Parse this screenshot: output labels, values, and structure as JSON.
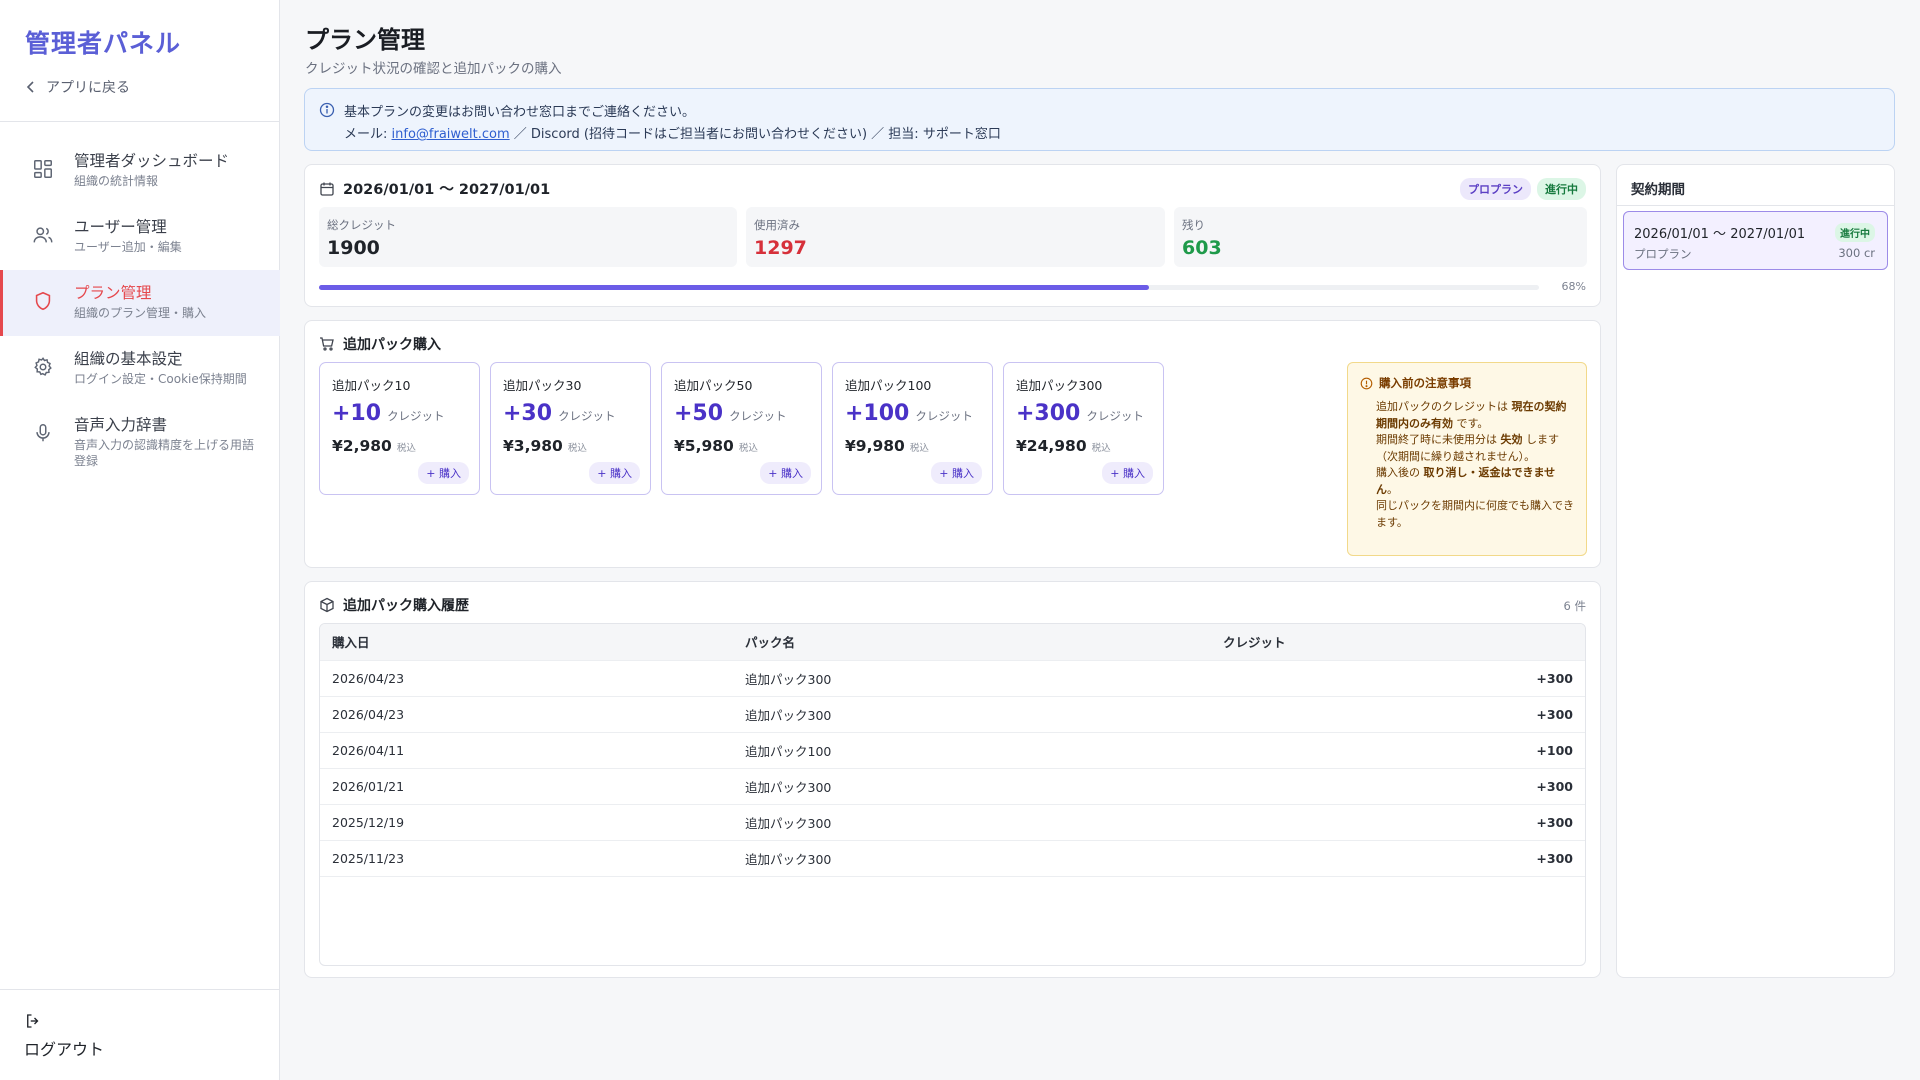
{
  "sidebar": {
    "brand": "管理者パネル",
    "back_label": "アプリに戻る",
    "items": [
      {
        "title": "管理者ダッシュボード",
        "sub": "組織の統計情報",
        "icon": "dashboard-icon"
      },
      {
        "title": "ユーザー管理",
        "sub": "ユーザー追加・編集",
        "icon": "users-icon"
      },
      {
        "title": "プラン管理",
        "sub": "組織のプラン管理・購入",
        "icon": "shield-icon"
      },
      {
        "title": "組織の基本設定",
        "sub": "ログイン設定・Cookie保持期間",
        "icon": "gear-icon"
      },
      {
        "title": "音声入力辞書",
        "sub": "音声入力の認識精度を上げる用語登録",
        "icon": "microphone-icon"
      }
    ],
    "logout_label": "ログアウト"
  },
  "header": {
    "title": "プラン管理",
    "subtitle": "クレジット状況の確認と追加パックの購入"
  },
  "info": {
    "line1": "基本プランの変更はお問い合わせ窓口までご連絡ください。",
    "mail_prefix": "メール: ",
    "mail": "info@fraiwelt.com",
    "line2_rest": " ／ Discord (招待コードはご担当者にお問い合わせください) ／ 担当: サポート窓口"
  },
  "credit": {
    "period": "2026/01/01 〜 2027/01/01",
    "plan_badge": "プロプラン",
    "status_badge": "進行中",
    "total_label": "総クレジット",
    "total_value": "1900",
    "used_label": "使用済み",
    "used_value": "1297",
    "remaining_label": "残り",
    "remaining_value": "603",
    "progress_label": "68%",
    "progress_fraction": 0.68
  },
  "packs": {
    "title": "追加パック購入",
    "unit": "クレジット",
    "tax": "税込",
    "buy_label": "+ 購入",
    "items": [
      {
        "name": "追加パック10",
        "credits": "+10",
        "price": "¥2,980"
      },
      {
        "name": "追加パック30",
        "credits": "+30",
        "price": "¥3,980"
      },
      {
        "name": "追加パック50",
        "credits": "+50",
        "price": "¥5,980"
      },
      {
        "name": "追加パック100",
        "credits": "+100",
        "price": "¥9,980"
      },
      {
        "name": "追加パック300",
        "credits": "+300",
        "price": "¥24,980"
      }
    ],
    "notice": {
      "title": "購入前の注意事項",
      "p1a": "追加パックのクレジットは ",
      "p1b": "現在の契約期間内のみ有効",
      "p1c": " です。",
      "p2a": "期間終了時に未使用分は ",
      "p2b": "失効",
      "p2c": " します（次期間に繰り越されません）。",
      "p3a": "購入後の ",
      "p3b": "取り消し・返金はできません",
      "p3c": "。",
      "p4": "同じパックを期間内に何度でも購入できます。"
    }
  },
  "history": {
    "title": "追加パック購入履歴",
    "count": "6 件",
    "columns": [
      "購入日",
      "パック名",
      "クレジット"
    ],
    "rows": [
      {
        "date": "2026/04/23",
        "pack": "追加パック300",
        "credit": "+300"
      },
      {
        "date": "2026/04/23",
        "pack": "追加パック300",
        "credit": "+300"
      },
      {
        "date": "2026/04/11",
        "pack": "追加パック100",
        "credit": "+100"
      },
      {
        "date": "2026/01/21",
        "pack": "追加パック300",
        "credit": "+300"
      },
      {
        "date": "2025/12/19",
        "pack": "追加パック300",
        "credit": "+300"
      },
      {
        "date": "2025/11/23",
        "pack": "追加パック300",
        "credit": "+300"
      }
    ]
  },
  "contract": {
    "title": "契約期間",
    "items": [
      {
        "period": "2026/01/01 〜 2027/01/01",
        "badge": "進行中",
        "plan": "プロプラン",
        "credits": "300 cr"
      }
    ]
  },
  "colors": {
    "accent": "#5b5fd6",
    "active_nav": "#e5484d",
    "used": "#d6303a",
    "remaining": "#1f9a4a",
    "pack_accent": "#4a32c7"
  }
}
